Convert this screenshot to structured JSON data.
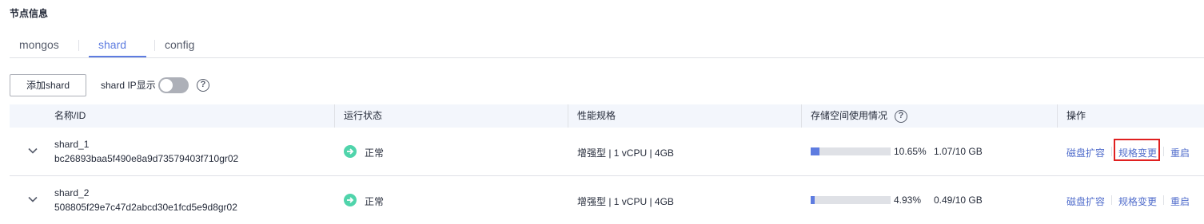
{
  "section_title": "节点信息",
  "tabs": [
    {
      "label": "mongos",
      "active": false
    },
    {
      "label": "shard",
      "active": true
    },
    {
      "label": "config",
      "active": false
    }
  ],
  "toolbar": {
    "add_button": "添加shard",
    "ip_toggle_label": "shard IP显示",
    "ip_toggle_on": false
  },
  "table": {
    "columns": [
      "名称/ID",
      "运行状态",
      "性能规格",
      "存储空间使用情况",
      "操作"
    ],
    "rows": [
      {
        "name": "shard_1",
        "id": "bc26893baa5f490e8a9d73579403f710gr02",
        "status": "正常",
        "spec": "增强型 | 1 vCPU | 4GB",
        "usage_fraction": 0.1065,
        "usage_percent": "10.65%",
        "usage_amount": "1.07/10 GB",
        "actions": [
          "磁盘扩容",
          "规格变更",
          "重启"
        ]
      },
      {
        "name": "shard_2",
        "id": "508805f29e7c47d2abcd30e1fcd5e9d8gr02",
        "status": "正常",
        "spec": "增强型 | 1 vCPU | 4GB",
        "usage_fraction": 0.0493,
        "usage_percent": "4.93%",
        "usage_amount": "0.49/10 GB",
        "actions": [
          "磁盘扩容",
          "规格变更",
          "重启"
        ]
      }
    ]
  },
  "colors": {
    "accent": "#5e7ce0",
    "link": "#526ecc",
    "status_ok": "#50d4ab",
    "highlight": "#e02020"
  }
}
